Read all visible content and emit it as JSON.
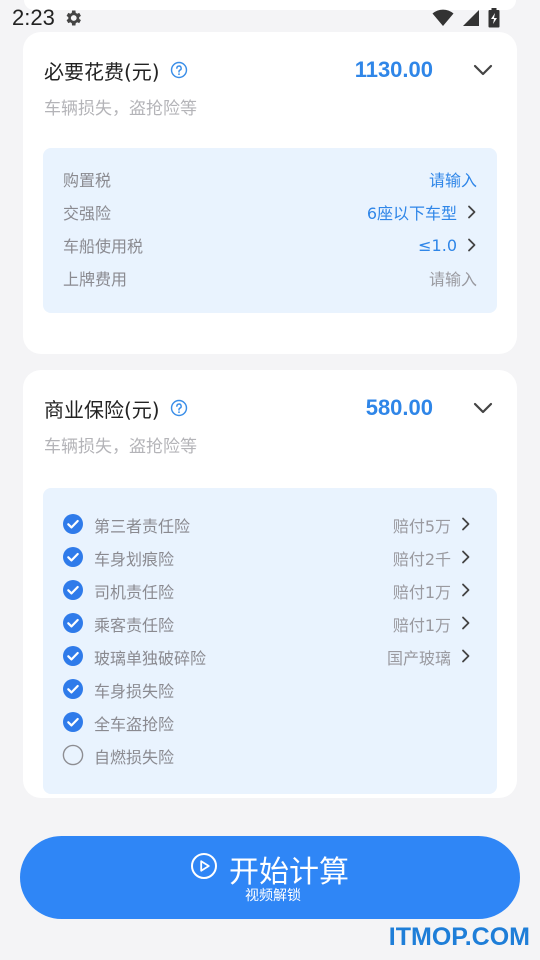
{
  "status_bar": {
    "time": "2:23",
    "icons": [
      "settings-gear-icon",
      "wifi-icon",
      "cellular-signal-icon",
      "battery-charging-icon"
    ]
  },
  "required_costs": {
    "title": "必要花费(元)",
    "total": "1130.00",
    "subtitle": "车辆损失，盗抢险等",
    "items": [
      {
        "label": "购置税",
        "value": "请输入",
        "value_style": "blue",
        "has_arrow": false
      },
      {
        "label": "交强险",
        "value": "6座以下车型",
        "value_style": "blue",
        "has_arrow": true
      },
      {
        "label": "车船使用税",
        "value": "≤1.0",
        "value_style": "blue",
        "has_arrow": true
      },
      {
        "label": "上牌费用",
        "value": "请输入",
        "value_style": "gray",
        "has_arrow": false
      }
    ]
  },
  "commercial_insurance": {
    "title": "商业保险(元)",
    "total": "580.00",
    "subtitle": "车辆损失，盗抢险等",
    "items": [
      {
        "label": "第三者责任险",
        "checked": true,
        "value": "赔付5万"
      },
      {
        "label": "车身划痕险",
        "checked": true,
        "value": "赔付2千"
      },
      {
        "label": "司机责任险",
        "checked": true,
        "value": "赔付1万"
      },
      {
        "label": "乘客责任险",
        "checked": true,
        "value": "赔付1万"
      },
      {
        "label": "玻璃单独破碎险",
        "checked": true,
        "value": "国产玻璃"
      },
      {
        "label": "车身损失险",
        "checked": true,
        "value": ""
      },
      {
        "label": "全车盗抢险",
        "checked": true,
        "value": ""
      },
      {
        "label": "自燃损失险",
        "checked": false,
        "value": ""
      }
    ]
  },
  "start_button": {
    "label": "开始计算",
    "sublabel": "视频解锁"
  },
  "watermark": "ITMOP.COM",
  "colors": {
    "accent": "#2f86e8",
    "button": "#2f86f6",
    "inner_panel": "#e9f3fe",
    "check": "#2f7bea"
  }
}
